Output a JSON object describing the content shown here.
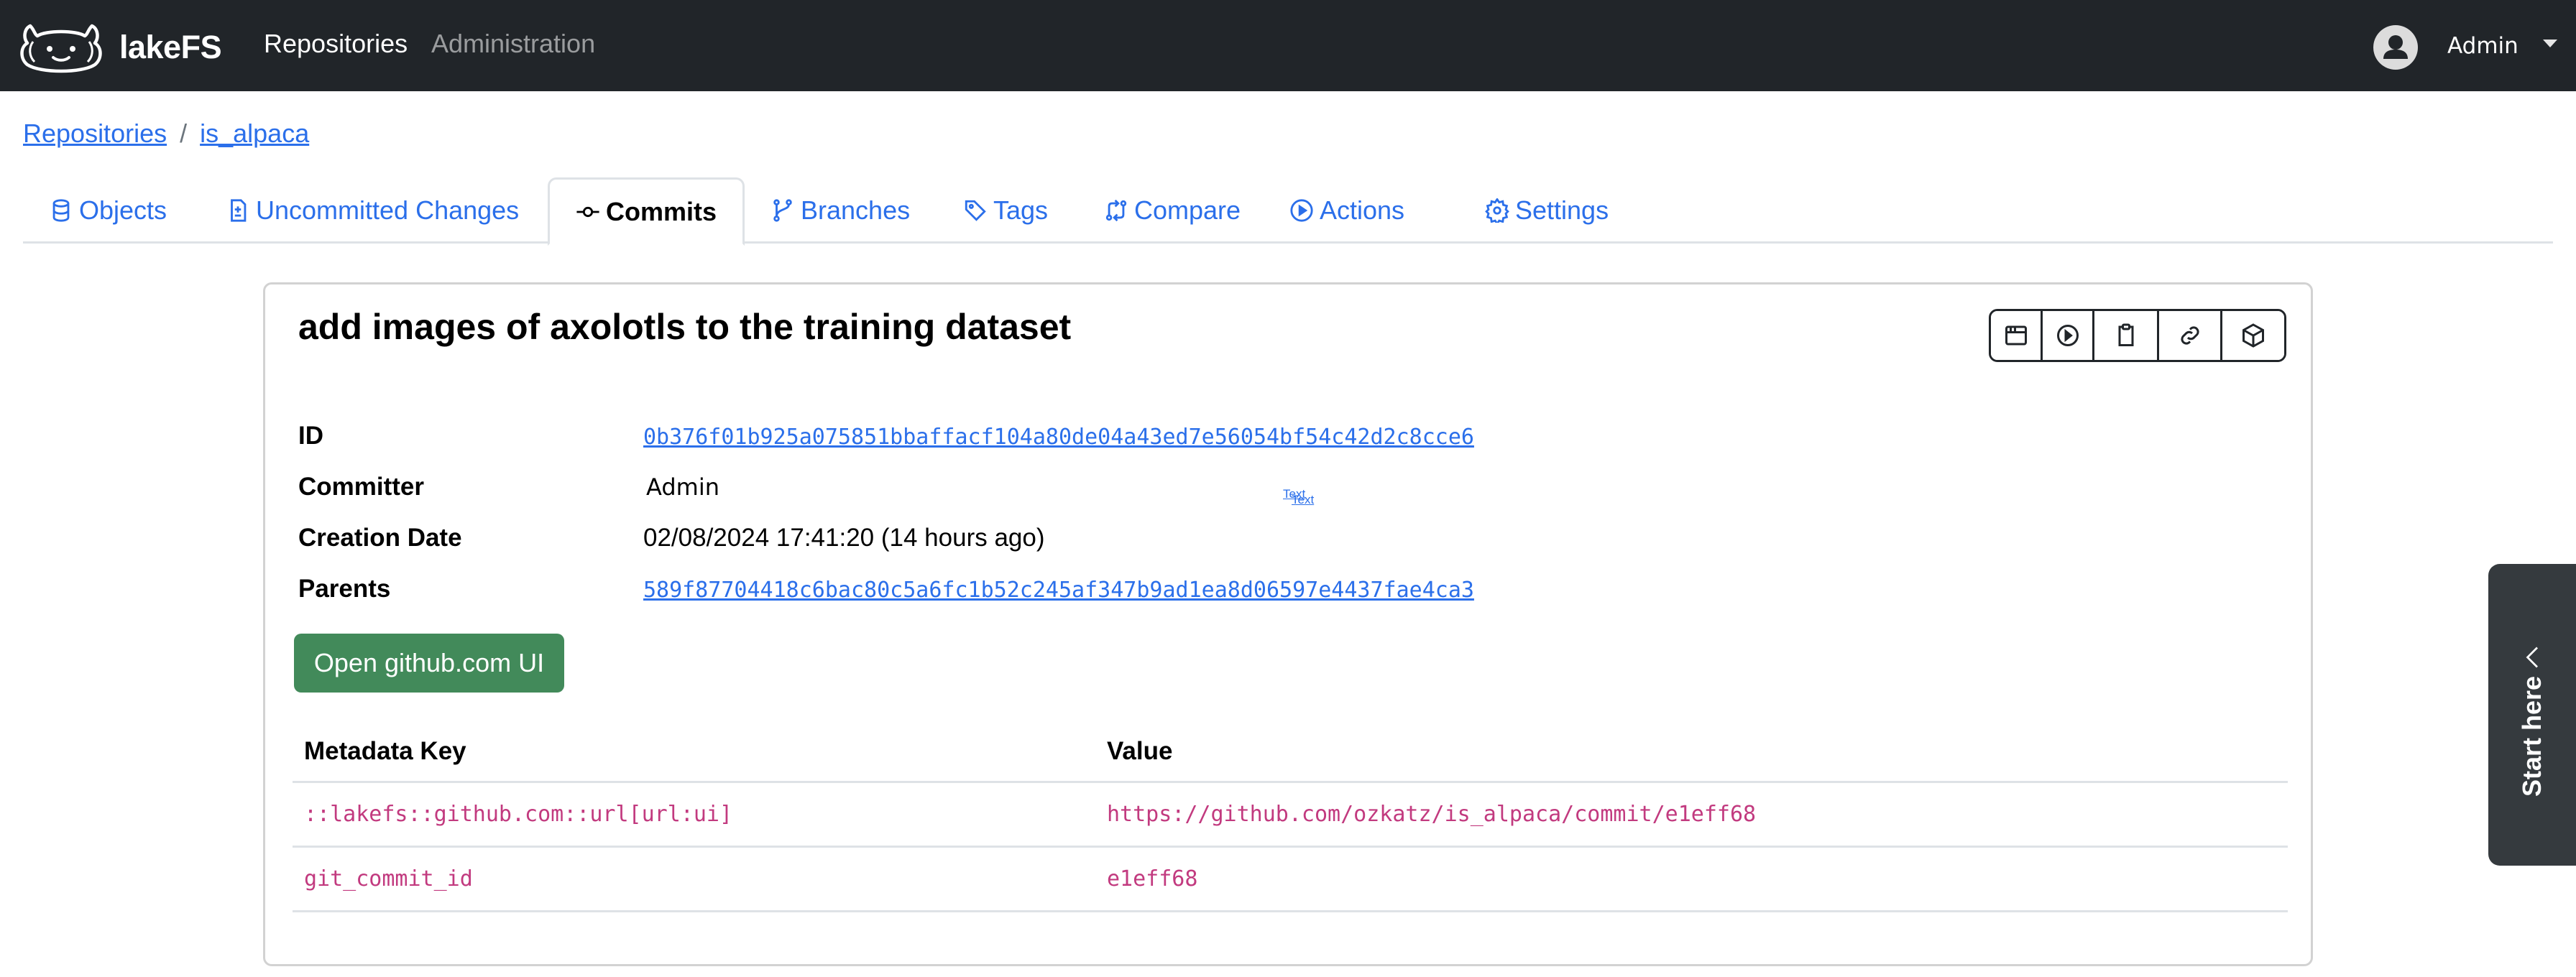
{
  "navbar": {
    "brand": "lakeFS",
    "links": [
      {
        "label": "Repositories",
        "active": true
      },
      {
        "label": "Administration",
        "active": false
      }
    ],
    "user": {
      "name": "Admin",
      "icon": "user-avatar-icon"
    }
  },
  "breadcrumb": {
    "items": [
      "Repositories",
      "is_alpaca"
    ],
    "separator": "/"
  },
  "tabs": [
    {
      "label": "Objects",
      "icon": "database-icon",
      "active": false
    },
    {
      "label": "Uncommitted Changes",
      "icon": "file-diff-icon",
      "active": false
    },
    {
      "label": "Commits",
      "icon": "git-commit-icon",
      "active": true
    },
    {
      "label": "Branches",
      "icon": "git-branch-icon",
      "active": false
    },
    {
      "label": "Tags",
      "icon": "tag-icon",
      "active": false
    },
    {
      "label": "Compare",
      "icon": "git-compare-icon",
      "active": false
    },
    {
      "label": "Actions",
      "icon": "play-circle-icon",
      "active": false
    },
    {
      "label": "Settings",
      "icon": "gear-icon",
      "active": false
    }
  ],
  "commit": {
    "message": "add images of axolotls to the training dataset",
    "actions": [
      {
        "name": "browse-objects",
        "icon": "browser-icon"
      },
      {
        "name": "show-actions",
        "icon": "play-circle-icon"
      },
      {
        "name": "copy-id",
        "icon": "clipboard-icon"
      },
      {
        "name": "copy-link",
        "icon": "link-icon"
      },
      {
        "name": "view-package",
        "icon": "package-icon"
      }
    ],
    "details": {
      "id_label": "ID",
      "id": "0b376f01b925a075851bbaffacf104a80de04a43ed7e56054bf54c42d2c8cce6",
      "committer_label": "Committer",
      "committer": "Admin",
      "date_label": "Creation Date",
      "date": "02/08/2024 17:41:20 (14 hours ago)",
      "parents_label": "Parents",
      "parent": "589f87704418c6bac80c5a6fc1b52c245af347b9ad1ea8d06597e4437fae4ca3"
    },
    "overlay_text": [
      "Text",
      "Text"
    ],
    "github_button": "Open github.com UI",
    "metadata": {
      "headers": [
        "Metadata Key",
        "Value"
      ],
      "rows": [
        [
          "::lakefs::github.com::url[url:ui]",
          "https://github.com/ozkatz/is_alpaca/commit/e1eff68"
        ],
        [
          "git_commit_id",
          "e1eff68"
        ]
      ]
    }
  },
  "start_here": {
    "label": "Start here"
  },
  "colors": {
    "navbar_bg": "#212529",
    "link": "#2b6fea",
    "success_button": "#428a5a",
    "code_text": "#c23a7f",
    "start_here_bg": "#353a3e"
  }
}
